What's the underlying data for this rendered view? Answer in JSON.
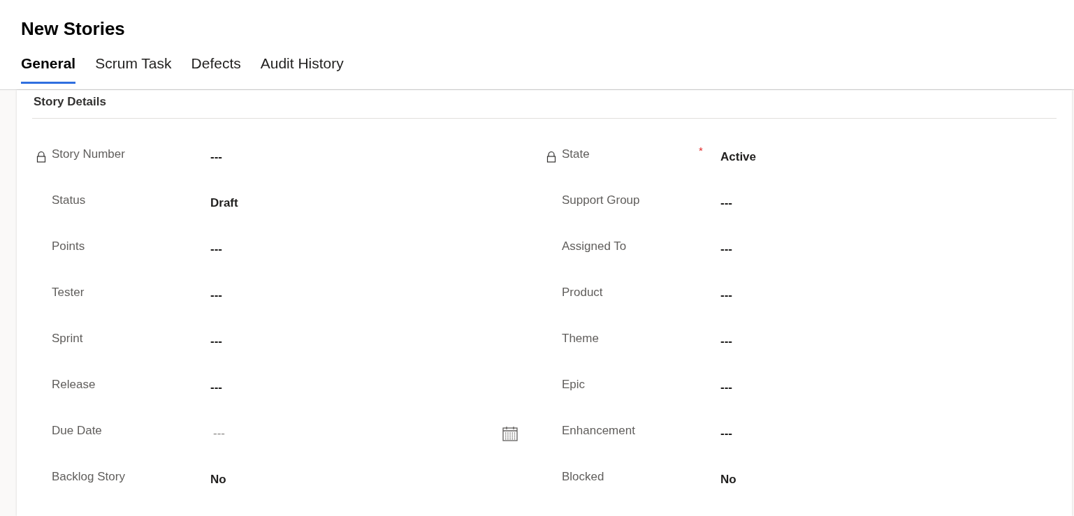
{
  "title": "New Stories",
  "tabs": [
    {
      "label": "General",
      "selected": true
    },
    {
      "label": "Scrum Task",
      "selected": false
    },
    {
      "label": "Defects",
      "selected": false
    },
    {
      "label": "Audit History",
      "selected": false
    }
  ],
  "section": {
    "title": "Story Details",
    "columns": [
      [
        {
          "label": "Story Number",
          "value": "---",
          "locked": true,
          "kind": "text"
        },
        {
          "label": "Status",
          "value": "Draft",
          "locked": false,
          "kind": "text"
        },
        {
          "label": "Points",
          "value": "---",
          "locked": false,
          "kind": "text"
        },
        {
          "label": "Tester",
          "value": "---",
          "locked": false,
          "kind": "text"
        },
        {
          "label": "Sprint",
          "value": "---",
          "locked": false,
          "kind": "text"
        },
        {
          "label": "Release",
          "value": "---",
          "locked": false,
          "kind": "text"
        },
        {
          "label": "Due Date",
          "placeholder": "---",
          "locked": false,
          "kind": "date"
        },
        {
          "label": "Backlog Story",
          "value": "No",
          "locked": false,
          "kind": "text"
        }
      ],
      [
        {
          "label": "State",
          "value": "Active",
          "locked": true,
          "required_mark": "*",
          "kind": "text"
        },
        {
          "label": "Support Group",
          "value": "---",
          "locked": false,
          "kind": "text"
        },
        {
          "label": "Assigned To",
          "value": "---",
          "locked": false,
          "kind": "text"
        },
        {
          "label": "Product",
          "value": "---",
          "locked": false,
          "kind": "text"
        },
        {
          "label": "Theme",
          "value": "---",
          "locked": false,
          "kind": "text"
        },
        {
          "label": "Epic",
          "value": "---",
          "locked": false,
          "kind": "text"
        },
        {
          "label": "Enhancement",
          "value": "---",
          "locked": false,
          "kind": "text"
        },
        {
          "label": "Blocked",
          "value": "No",
          "locked": false,
          "kind": "text"
        }
      ]
    ]
  }
}
